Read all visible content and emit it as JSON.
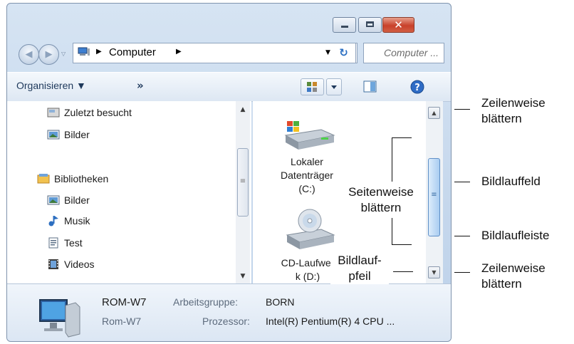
{
  "window": {
    "close_glyph": "✕",
    "address": {
      "crumb": "Computer",
      "sep": "▶",
      "dropdown": "▼"
    },
    "refresh_glyph": "↻",
    "search_placeholder": "Computer ..."
  },
  "toolbar": {
    "organize": "Organisieren ▼",
    "more": "»"
  },
  "nav": {
    "items": [
      {
        "label": "Zuletzt besucht",
        "icon": "recent-places-icon"
      },
      {
        "label": "Bilder",
        "icon": "pictures-folder-icon"
      },
      {
        "label": "Bibliotheken",
        "icon": "libraries-icon"
      },
      {
        "label": "Bilder",
        "icon": "pictures-library-icon"
      },
      {
        "label": "Musik",
        "icon": "music-library-icon"
      },
      {
        "label": "Test",
        "icon": "test-library-icon"
      },
      {
        "label": "Videos",
        "icon": "videos-library-icon"
      }
    ]
  },
  "drives": [
    {
      "label_lines": [
        "Lokaler",
        "Datenträger",
        "(C:)"
      ],
      "icon": "local-disk-icon"
    },
    {
      "label_lines": [
        "CD-Laufwer",
        "k (D:)"
      ],
      "icon": "cd-drive-icon"
    }
  ],
  "details": {
    "name": "ROM-W7",
    "subname": "Rom-W7",
    "workgroup_label": "Arbeitsgruppe:",
    "workgroup_value": "BORN",
    "cpu_label": "Prozessor:",
    "cpu_value": "Intel(R) Pentium(R) 4 CPU ..."
  },
  "annotations": {
    "zeilenweise_top": [
      "Zeilenweise",
      "blättern"
    ],
    "bildlauffeld": "Bildlauffeld",
    "bildlaufleiste": "Bildlaufleiste",
    "zeilenweise_bottom": [
      "Zeilenweise",
      "blättern"
    ],
    "seitenweise": [
      "Seitenweise",
      "blättern"
    ],
    "bildlaufpfeil": [
      "Bildlauf-",
      "pfeil"
    ]
  },
  "colors": {
    "close_red": "#c8412b",
    "accent_blue": "#2b6fc2"
  }
}
